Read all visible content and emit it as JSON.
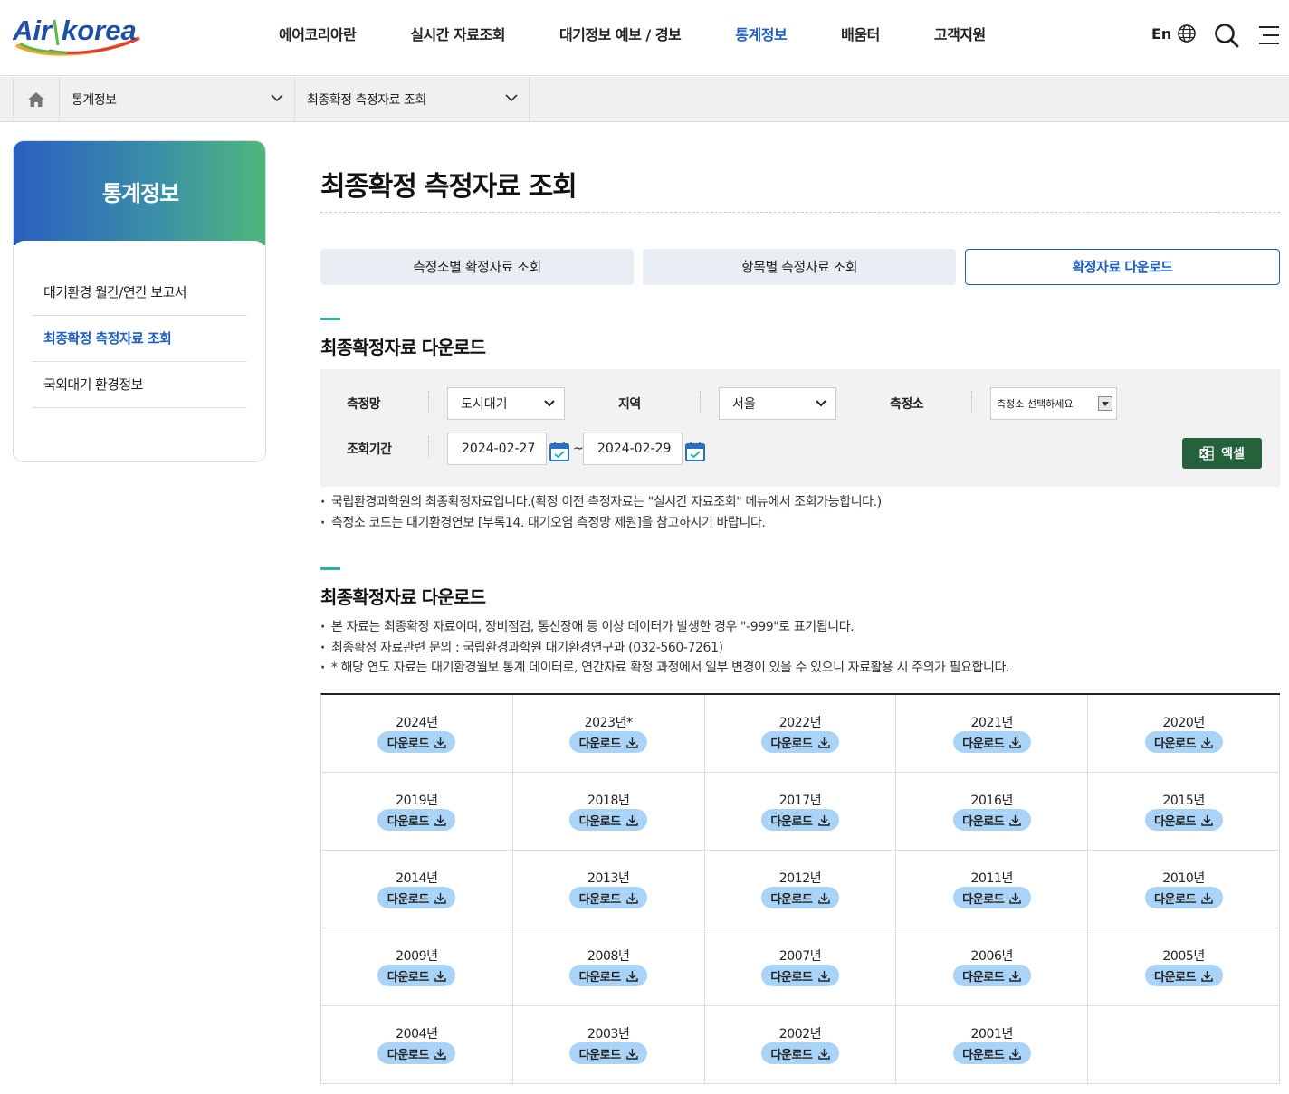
{
  "header": {
    "logo_text": "Airkorea",
    "nav": [
      {
        "label": "에어코리아란"
      },
      {
        "label": "실시간 자료조회"
      },
      {
        "label": "대기정보 예보 / 경보"
      },
      {
        "label": "통계정보"
      },
      {
        "label": "배움터"
      },
      {
        "label": "고객지원"
      }
    ],
    "active_nav": "통계정보",
    "lang_label": "En",
    "accent_color": "#1f5fc2"
  },
  "breadcrumb": {
    "level1": "통계정보",
    "level2": "최종확정 측정자료 조회"
  },
  "sidebar": {
    "title": "통계정보",
    "items": [
      {
        "label": "대기환경 월간/연간 보고서"
      },
      {
        "label": "최종확정 측정자료 조회"
      },
      {
        "label": "국외대기 환경정보"
      }
    ],
    "active_item": "최종확정 측정자료 조회"
  },
  "main": {
    "title": "최종확정 측정자료 조회",
    "tabs": [
      {
        "label": "측정소별 확정자료 조회"
      },
      {
        "label": "항목별 측정자료 조회"
      },
      {
        "label": "확정자료 다운로드"
      }
    ],
    "active_tab": "확정자료 다운로드",
    "section1": {
      "title": "최종확정자료 다운로드",
      "filter": {
        "network_label": "측정망",
        "network_value": "도시대기",
        "region_label": "지역",
        "region_value": "서울",
        "station_label": "측정소",
        "station_placeholder": "측정소 선택하세요",
        "period_label": "조회기간",
        "start_date": "2024-02-27",
        "tilde": "~",
        "end_date": "2024-02-29",
        "excel_label": "엑셀"
      },
      "notes": [
        "국립환경과학원의 최종확정자료입니다.(확정 이전 측정자료는 \"실시간 자료조회\" 메뉴에서 조회가능합니다.)",
        "측정소 코드는 대기환경연보 [부록14. 대기오염 측정망 제원]을 참고하시기 바랍니다."
      ]
    },
    "section2": {
      "title": "최종확정자료 다운로드",
      "notes": [
        "본 자료는 최종확정 자료이며, 장비점검, 통신장애 등 이상 데이터가 발생한 경우 \"-999\"로 표기됩니다.",
        "최종확정 자료관련 문의 : 국립환경과학원 대기환경연구과 (032-560-7261)",
        "* 해당 연도 자료는 대기환경월보 통계 데이터로, 연간자료 확정 과정에서 일부 변경이 있을 수 있으니 자료활용 시 주의가 필요합니다."
      ],
      "download_label": "다운로드",
      "years": [
        [
          "2024년",
          "2023년*",
          "2022년",
          "2021년",
          "2020년"
        ],
        [
          "2019년",
          "2018년",
          "2017년",
          "2016년",
          "2015년"
        ],
        [
          "2014년",
          "2013년",
          "2012년",
          "2011년",
          "2010년"
        ],
        [
          "2009년",
          "2008년",
          "2007년",
          "2006년",
          "2005년"
        ],
        [
          "2004년",
          "2003년",
          "2002년",
          "2001년",
          ""
        ]
      ]
    }
  }
}
